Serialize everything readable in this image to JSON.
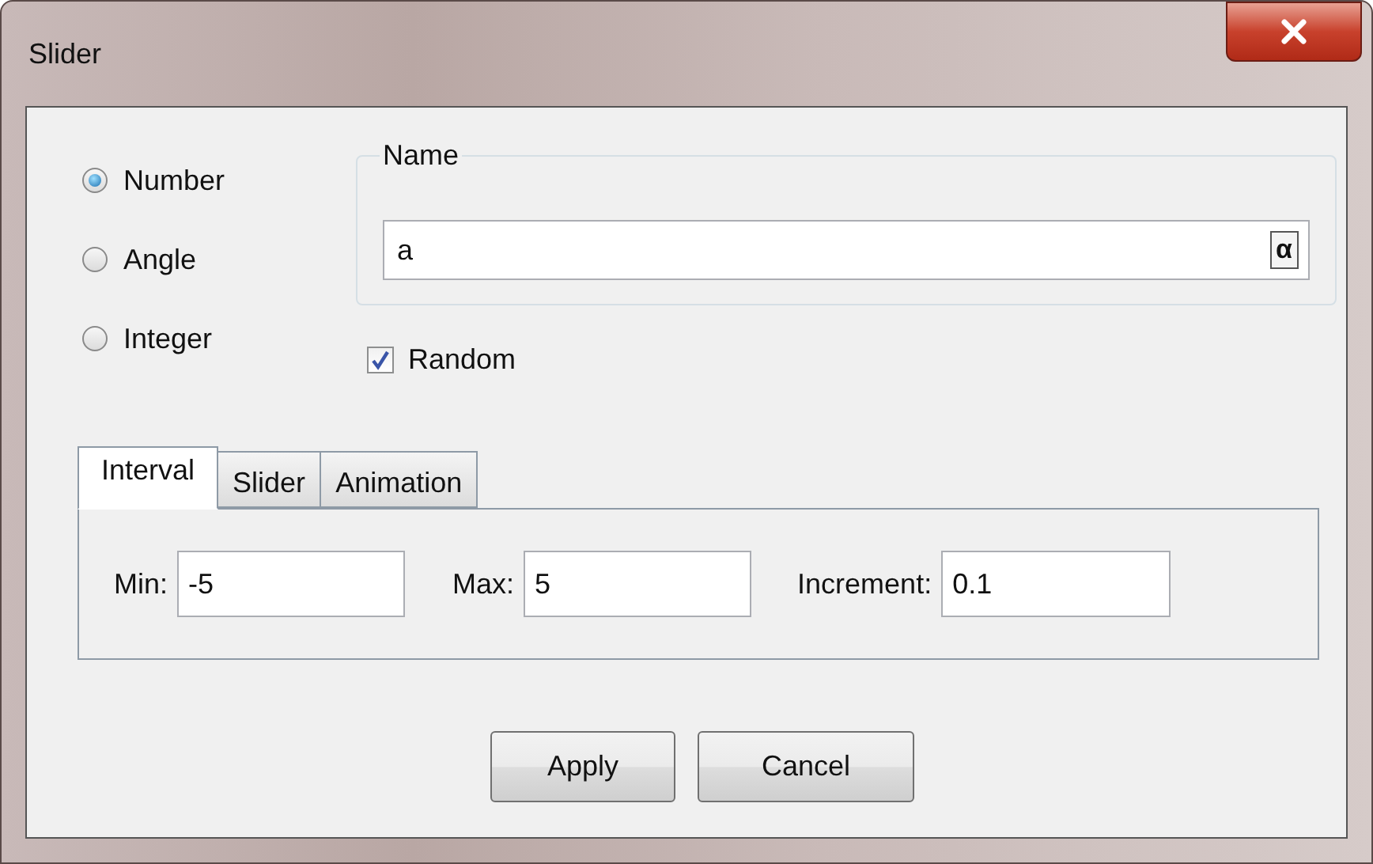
{
  "window": {
    "title": "Slider"
  },
  "slider_types": [
    {
      "label": "Number",
      "selected": true
    },
    {
      "label": "Angle",
      "selected": false
    },
    {
      "label": "Integer",
      "selected": false
    }
  ],
  "name_group": {
    "legend": "Name",
    "value": "a",
    "symbol_button": "α"
  },
  "random": {
    "label": "Random",
    "checked": true
  },
  "tabs": [
    {
      "label": "Interval",
      "selected": true
    },
    {
      "label": "Slider",
      "selected": false
    },
    {
      "label": "Animation",
      "selected": false
    }
  ],
  "interval_fields": [
    {
      "label": "Min:",
      "value": "-5"
    },
    {
      "label": "Max:",
      "value": "5"
    },
    {
      "label": "Increment:",
      "value": "0.1"
    }
  ],
  "buttons": [
    "Apply",
    "Cancel"
  ]
}
